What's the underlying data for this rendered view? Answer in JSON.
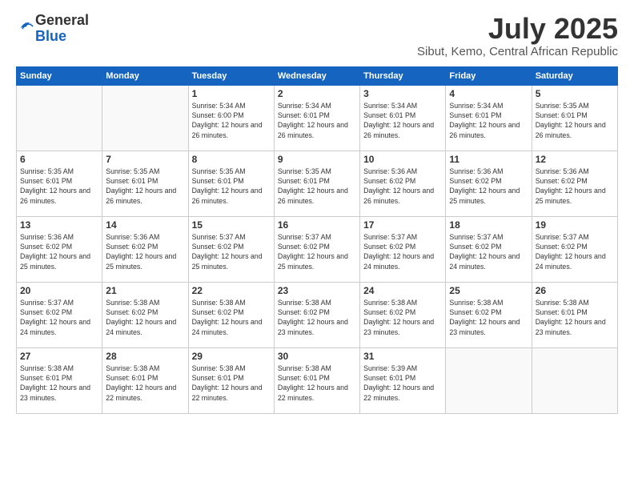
{
  "header": {
    "logo_general": "General",
    "logo_blue": "Blue",
    "month_year": "July 2025",
    "location": "Sibut, Kemo, Central African Republic"
  },
  "calendar": {
    "days_of_week": [
      "Sunday",
      "Monday",
      "Tuesday",
      "Wednesday",
      "Thursday",
      "Friday",
      "Saturday"
    ],
    "weeks": [
      [
        {
          "day": "",
          "info": ""
        },
        {
          "day": "",
          "info": ""
        },
        {
          "day": "1",
          "info": "Sunrise: 5:34 AM\nSunset: 6:00 PM\nDaylight: 12 hours and 26 minutes."
        },
        {
          "day": "2",
          "info": "Sunrise: 5:34 AM\nSunset: 6:01 PM\nDaylight: 12 hours and 26 minutes."
        },
        {
          "day": "3",
          "info": "Sunrise: 5:34 AM\nSunset: 6:01 PM\nDaylight: 12 hours and 26 minutes."
        },
        {
          "day": "4",
          "info": "Sunrise: 5:34 AM\nSunset: 6:01 PM\nDaylight: 12 hours and 26 minutes."
        },
        {
          "day": "5",
          "info": "Sunrise: 5:35 AM\nSunset: 6:01 PM\nDaylight: 12 hours and 26 minutes."
        }
      ],
      [
        {
          "day": "6",
          "info": "Sunrise: 5:35 AM\nSunset: 6:01 PM\nDaylight: 12 hours and 26 minutes."
        },
        {
          "day": "7",
          "info": "Sunrise: 5:35 AM\nSunset: 6:01 PM\nDaylight: 12 hours and 26 minutes."
        },
        {
          "day": "8",
          "info": "Sunrise: 5:35 AM\nSunset: 6:01 PM\nDaylight: 12 hours and 26 minutes."
        },
        {
          "day": "9",
          "info": "Sunrise: 5:35 AM\nSunset: 6:01 PM\nDaylight: 12 hours and 26 minutes."
        },
        {
          "day": "10",
          "info": "Sunrise: 5:36 AM\nSunset: 6:02 PM\nDaylight: 12 hours and 26 minutes."
        },
        {
          "day": "11",
          "info": "Sunrise: 5:36 AM\nSunset: 6:02 PM\nDaylight: 12 hours and 25 minutes."
        },
        {
          "day": "12",
          "info": "Sunrise: 5:36 AM\nSunset: 6:02 PM\nDaylight: 12 hours and 25 minutes."
        }
      ],
      [
        {
          "day": "13",
          "info": "Sunrise: 5:36 AM\nSunset: 6:02 PM\nDaylight: 12 hours and 25 minutes."
        },
        {
          "day": "14",
          "info": "Sunrise: 5:36 AM\nSunset: 6:02 PM\nDaylight: 12 hours and 25 minutes."
        },
        {
          "day": "15",
          "info": "Sunrise: 5:37 AM\nSunset: 6:02 PM\nDaylight: 12 hours and 25 minutes."
        },
        {
          "day": "16",
          "info": "Sunrise: 5:37 AM\nSunset: 6:02 PM\nDaylight: 12 hours and 25 minutes."
        },
        {
          "day": "17",
          "info": "Sunrise: 5:37 AM\nSunset: 6:02 PM\nDaylight: 12 hours and 24 minutes."
        },
        {
          "day": "18",
          "info": "Sunrise: 5:37 AM\nSunset: 6:02 PM\nDaylight: 12 hours and 24 minutes."
        },
        {
          "day": "19",
          "info": "Sunrise: 5:37 AM\nSunset: 6:02 PM\nDaylight: 12 hours and 24 minutes."
        }
      ],
      [
        {
          "day": "20",
          "info": "Sunrise: 5:37 AM\nSunset: 6:02 PM\nDaylight: 12 hours and 24 minutes."
        },
        {
          "day": "21",
          "info": "Sunrise: 5:38 AM\nSunset: 6:02 PM\nDaylight: 12 hours and 24 minutes."
        },
        {
          "day": "22",
          "info": "Sunrise: 5:38 AM\nSunset: 6:02 PM\nDaylight: 12 hours and 24 minutes."
        },
        {
          "day": "23",
          "info": "Sunrise: 5:38 AM\nSunset: 6:02 PM\nDaylight: 12 hours and 23 minutes."
        },
        {
          "day": "24",
          "info": "Sunrise: 5:38 AM\nSunset: 6:02 PM\nDaylight: 12 hours and 23 minutes."
        },
        {
          "day": "25",
          "info": "Sunrise: 5:38 AM\nSunset: 6:02 PM\nDaylight: 12 hours and 23 minutes."
        },
        {
          "day": "26",
          "info": "Sunrise: 5:38 AM\nSunset: 6:01 PM\nDaylight: 12 hours and 23 minutes."
        }
      ],
      [
        {
          "day": "27",
          "info": "Sunrise: 5:38 AM\nSunset: 6:01 PM\nDaylight: 12 hours and 23 minutes."
        },
        {
          "day": "28",
          "info": "Sunrise: 5:38 AM\nSunset: 6:01 PM\nDaylight: 12 hours and 22 minutes."
        },
        {
          "day": "29",
          "info": "Sunrise: 5:38 AM\nSunset: 6:01 PM\nDaylight: 12 hours and 22 minutes."
        },
        {
          "day": "30",
          "info": "Sunrise: 5:38 AM\nSunset: 6:01 PM\nDaylight: 12 hours and 22 minutes."
        },
        {
          "day": "31",
          "info": "Sunrise: 5:39 AM\nSunset: 6:01 PM\nDaylight: 12 hours and 22 minutes."
        },
        {
          "day": "",
          "info": ""
        },
        {
          "day": "",
          "info": ""
        }
      ]
    ]
  }
}
